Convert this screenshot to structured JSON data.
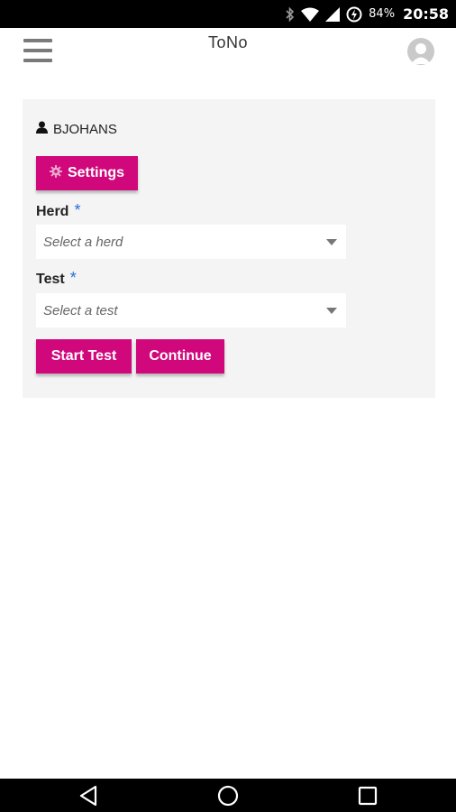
{
  "status_bar": {
    "battery_percent": "84%",
    "time": "20:58",
    "icons": [
      "bluetooth-icon",
      "wifi-icon",
      "signal-icon",
      "battery-charging-icon"
    ]
  },
  "header": {
    "title": "ToNo",
    "menu_icon": "hamburger-menu-icon",
    "avatar_icon": "user-avatar-icon"
  },
  "panel": {
    "username": "BJOHANS",
    "user_icon": "user-icon",
    "settings_label": "Settings",
    "settings_icon": "gear-icon",
    "herd": {
      "label": "Herd",
      "required_marker": "*",
      "placeholder": "Select a herd"
    },
    "test": {
      "label": "Test",
      "required_marker": "*",
      "placeholder": "Select a test"
    },
    "start_test_label": "Start Test",
    "continue_label": "Continue"
  },
  "colors": {
    "accent": "#d0087c",
    "required": "#2a6fd6",
    "panel_bg": "#f4f4f4"
  },
  "nav_bar": {
    "icons": [
      "back-icon",
      "home-icon",
      "recents-icon"
    ]
  }
}
